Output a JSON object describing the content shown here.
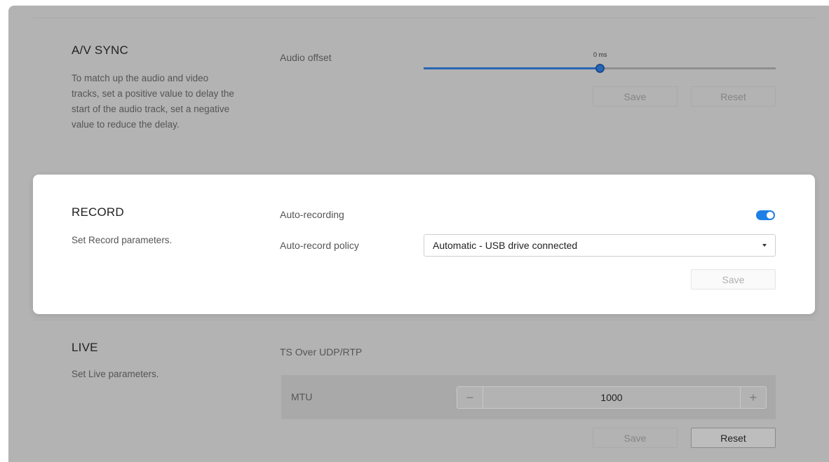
{
  "av_sync": {
    "title": "A/V SYNC",
    "description": "To match up the audio and video tracks, set a positive value to delay the start of the audio track, set a negative value to reduce the delay.",
    "audio_offset_label": "Audio offset",
    "audio_offset_value": "0 ms",
    "audio_offset_fraction": 0.5,
    "save_label": "Save",
    "reset_label": "Reset"
  },
  "record": {
    "title": "RECORD",
    "description": "Set Record parameters.",
    "auto_recording_label": "Auto-recording",
    "auto_recording_on": true,
    "policy_label": "Auto-record policy",
    "policy_value": "Automatic - USB drive connected",
    "save_label": "Save"
  },
  "live": {
    "title": "LIVE",
    "description": "Set Live parameters.",
    "protocol_label": "TS Over UDP/RTP",
    "mtu_label": "MTU",
    "mtu_value": "1000",
    "minus": "−",
    "plus": "+",
    "save_label": "Save",
    "reset_label": "Reset"
  },
  "colors": {
    "accent": "#2966b5",
    "toggle_on": "#1e7fe6",
    "overlay": "#b3b3b3"
  }
}
